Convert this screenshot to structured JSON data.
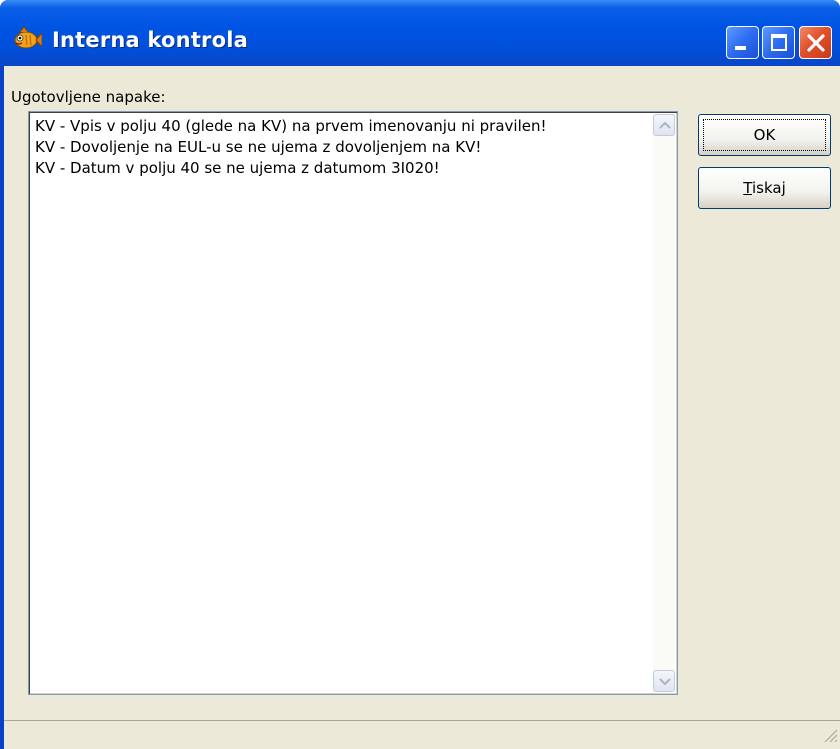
{
  "window": {
    "title": "Interna kontrola",
    "icon": "fish-icon",
    "controls": [
      "minimize-icon",
      "maximize-icon",
      "close-icon"
    ]
  },
  "errors": {
    "label": "Ugotovljene napake:",
    "items": [
      "KV - Vpis v polju 40 (glede na KV) na prvem imenovanju ni pravilen!",
      "KV - Dovoljenje na EUL-u se ne ujema z dovoljenjem na KV!",
      "KV - Datum v polju 40 se ne ujema z datumom 3I020!"
    ]
  },
  "buttons": {
    "ok_label": "OK",
    "print_label_rest": "iskaj",
    "print_label_mnemonic": "T"
  },
  "colors": {
    "titlebar": "#0054e3",
    "dialog_bg": "#ece9d8",
    "close_button": "#e2502c"
  }
}
